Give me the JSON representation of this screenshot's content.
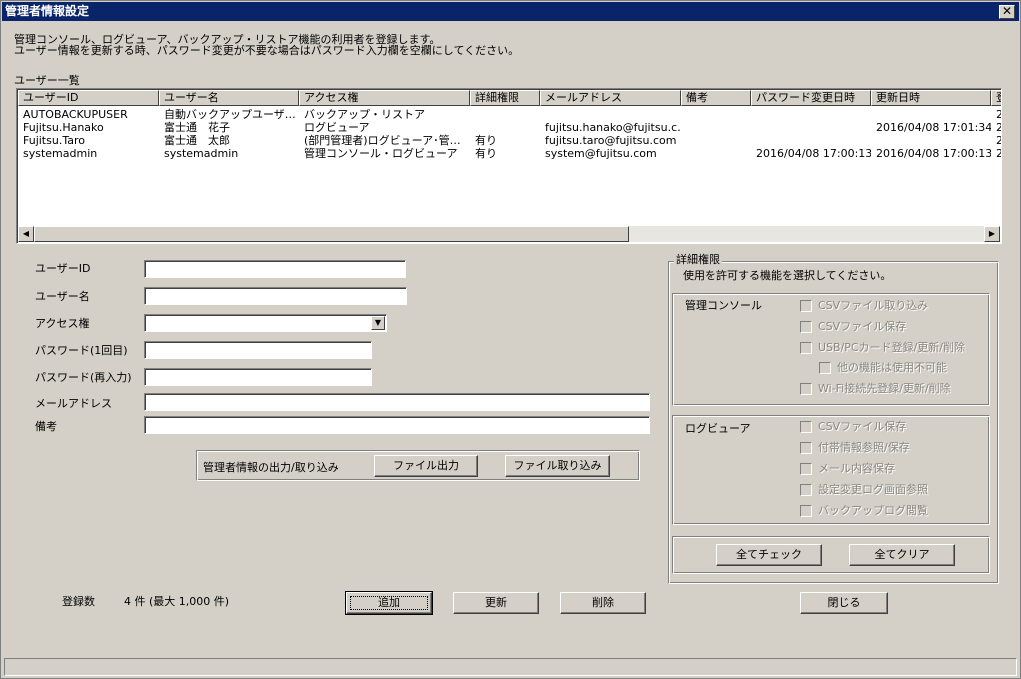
{
  "window": {
    "title": "管理者情報設定",
    "close": "✕"
  },
  "description": {
    "line1": "管理コンソール、ログビューア、バックアップ・リストア機能の利用者を登録します。",
    "line2": "ユーザー情報を更新する時、パスワード変更が不要な場合はパスワード入力欄を空欄にしてください。"
  },
  "user_list": {
    "label": "ユーザー一覧",
    "columns": [
      "ユーザーID",
      "ユーザー名",
      "アクセス権",
      "詳細権限",
      "メールアドレス",
      "備考",
      "パスワード変更日時",
      "更新日時",
      "登"
    ],
    "rows": [
      [
        "AUTOBACKUPUSER",
        "自動バックアップユーザ…",
        "バックアップ・リストア",
        "",
        "",
        "",
        "",
        "",
        "2"
      ],
      [
        "Fujitsu.Hanako",
        "富士通　花子",
        "ログビューア",
        "",
        "fujitsu.hanako@fujitsu.c…",
        "",
        "",
        "2016/04/08 17:01:34",
        "2"
      ],
      [
        "Fujitsu.Taro",
        "富士通　太郎",
        "(部門管理者)ログビューア･管…",
        "有り",
        "fujitsu.taro@fujitsu.com",
        "",
        "",
        "",
        "2"
      ],
      [
        "systemadmin",
        "systemadmin",
        "管理コンソール・ログビューア",
        "有り",
        "system@fujitsu.com",
        "",
        "2016/04/08 17:00:13",
        "2016/04/08 17:00:13",
        "2"
      ]
    ]
  },
  "form": {
    "user_id_label": "ユーザーID",
    "user_id_value": "",
    "user_name_label": "ユーザー名",
    "user_name_value": "",
    "access_label": "アクセス権",
    "access_value": "",
    "password1_label": "パスワード(1回目)",
    "password2_label": "パスワード(再入力)",
    "email_label": "メールアドレス",
    "email_value": "",
    "note_label": "備考",
    "note_value": ""
  },
  "io_panel": {
    "label": "管理者情報の出力/取り込み",
    "export_button": "ファイル出力",
    "import_button": "ファイル取り込み"
  },
  "permissions": {
    "title": "詳細権限",
    "instruction": "使用を許可する機能を選択してください。",
    "console_group": {
      "label": "管理コンソール",
      "items": [
        "CSVファイル取り込み",
        "CSVファイル保存",
        "USB/PCカード登録/更新/削除",
        "他の機能は使用不可能",
        "Wi-Fi接続先登録/更新/削除"
      ]
    },
    "viewer_group": {
      "label": "ログビューア",
      "items": [
        "CSVファイル保存",
        "付帯情報参照/保存",
        "メール内容保存",
        "設定変更ログ画面参照",
        "バックアップログ閲覧"
      ]
    },
    "check_all": "全てチェック",
    "clear_all": "全てクリア"
  },
  "footer": {
    "count_label": "登録数",
    "count_value": "4 件 (最大 1,000 件)",
    "add_button": "追加",
    "update_button": "更新",
    "delete_button": "削除",
    "close_button": "閉じる"
  }
}
